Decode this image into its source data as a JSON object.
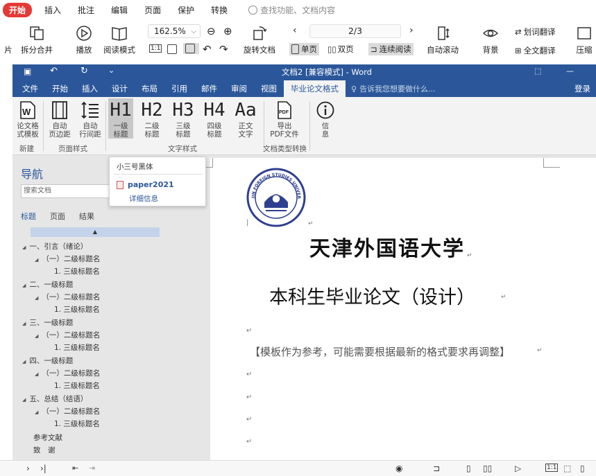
{
  "outer_menu": [
    "开始",
    "插入",
    "批注",
    "编辑",
    "页面",
    "保护",
    "转换"
  ],
  "outer_search": "查找功能、文档内容",
  "outer_toolbar": {
    "cut_label": "片",
    "split_merge": "拆分合并",
    "play": "播放",
    "read_mode": "阅读模式",
    "zoom": "162.5%",
    "rotate": "旋转文档",
    "page_indicator": "2/3",
    "single_page": "单页",
    "double_page": "双页",
    "continuous": "连续阅读",
    "auto_scroll": "自动滚动",
    "word_translate": "划词翻译",
    "background": "背景",
    "full_translate": "全文翻译",
    "compress": "压缩"
  },
  "word": {
    "title": "文档2 [兼容模式] - Word",
    "tabs": [
      "文件",
      "开始",
      "插入",
      "设计",
      "布局",
      "引用",
      "邮件",
      "审阅",
      "视图",
      "毕业论文格式"
    ],
    "tell_me": "告诉我您想要做什么...",
    "login": "登录",
    "ribbon": {
      "template": [
        "论文格",
        "式模板"
      ],
      "margin": [
        "自动",
        "页边距"
      ],
      "line_spacing": [
        "自动",
        "行间距"
      ],
      "h1": [
        "H1",
        "一级",
        "标题"
      ],
      "h2": [
        "H2",
        "二级",
        "标题"
      ],
      "h3": [
        "H3",
        "三级",
        "标题"
      ],
      "h4": [
        "H4",
        "四级",
        "标题"
      ],
      "body": [
        "Aa",
        "正文",
        "文字"
      ],
      "pdf": [
        "导出",
        "PDF文件"
      ],
      "info": [
        "信",
        "息"
      ],
      "groups": [
        "新建",
        "页面样式",
        "文字样式",
        "文档类型转换"
      ]
    }
  },
  "tooltip": {
    "title": "小三号黑体",
    "file": "paper2021",
    "detail": "详细信息"
  },
  "nav": {
    "title": "导航",
    "search_placeholder": "搜索文档",
    "tabs": [
      "标题",
      "页面",
      "结果"
    ],
    "items": [
      "一、引言（绪论）",
      "（一）二级标题名",
      "1. 三级标题名",
      "二、一级标题",
      "（一）二级标题名",
      "1. 三级标题名",
      "三、一级标题",
      "（一）二级标题名",
      "1. 三级标题名",
      "四、一级标题",
      "（一）二级标题名",
      "1. 三级标题名",
      "五、总结（结语）",
      "（一）二级标题名",
      "1. 三级标题名",
      "参考文献",
      "致　谢"
    ]
  },
  "document": {
    "university": "天津外国语大学",
    "title": "本科生毕业论文（设计）",
    "note": "【模板作为参考，可能需要根据最新的格式要求再调整】",
    "para_mark": "↵",
    "seal_text": "TIANJIN FOREIGN STUDIES UNIVERSITY"
  },
  "colors": {
    "word_blue": "#2b579a",
    "start_red": "#e53935"
  }
}
